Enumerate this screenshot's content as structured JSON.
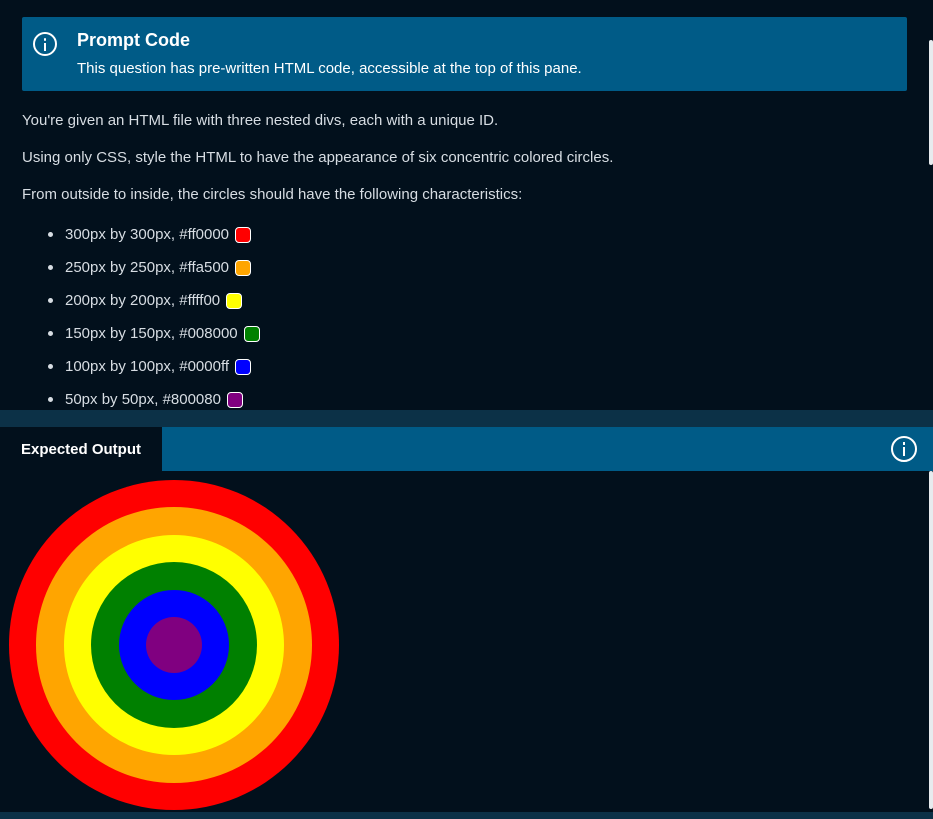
{
  "callout": {
    "title": "Prompt Code",
    "text": "This question has pre-written HTML code, accessible at the top of this pane.",
    "icon": "info-icon"
  },
  "instructions": {
    "p1": "You're given an HTML file with three nested divs, each with a unique ID.",
    "p2": "Using only CSS, style the HTML to have the appearance of six concentric colored circles.",
    "p3": "From outside to inside, the circles should have the following characteristics:"
  },
  "circles": [
    {
      "label": "300px by 300px, #ff0000",
      "color": "#ff0000"
    },
    {
      "label": "250px by 250px, #ffa500",
      "color": "#ffa500"
    },
    {
      "label": "200px by 200px, #ffff00",
      "color": "#ffff00"
    },
    {
      "label": "150px by 150px, #008000",
      "color": "#008000"
    },
    {
      "label": "100px by 100px, #0000ff",
      "color": "#0000ff"
    },
    {
      "label": "50px by 50px, #800080",
      "color": "#800080"
    }
  ],
  "output": {
    "tab_label": "Expected Output",
    "icon": "info-icon"
  },
  "theme": {
    "accent": "#005b87",
    "background": "#02101c"
  }
}
